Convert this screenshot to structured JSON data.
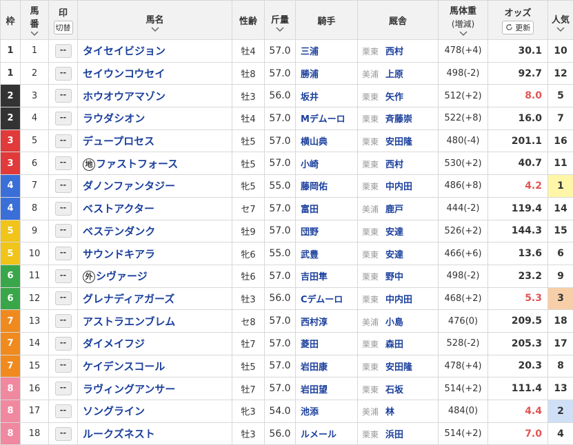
{
  "header": {
    "waku": "枠",
    "umaban_top": "馬",
    "umaban_bottom": "番",
    "mark": "印",
    "mark_toggle": "切替",
    "horse_name": "馬名",
    "sex_age": "性齢",
    "kinryo": "斤量",
    "jockey": "騎手",
    "stable": "厩舎",
    "body_weight": "馬体重",
    "body_weight_sub": "(増減)",
    "odds": "オッズ",
    "refresh": "更新",
    "popularity": "人気"
  },
  "mark_placeholder": "--",
  "colors": {
    "waku": {
      "1": "#ffffff",
      "2": "#333333",
      "3": "#e03a3a",
      "4": "#3a6fd8",
      "5": "#f0c419",
      "6": "#3aa64a",
      "7": "#f08a1e",
      "8": "#f088a0"
    },
    "name_blue": "#1a3f9c",
    "odds_red": "#e05555",
    "ninki1_bg": "#fff6a8",
    "ninki2_bg": "#cfe0f6",
    "ninki3_bg": "#f6cfa8"
  },
  "rows": [
    {
      "waku": "1",
      "umaban": "1",
      "name": "タイセイビジョン",
      "badge": "",
      "sex_age": "牡4",
      "weight": "57.0",
      "jockey": "三浦",
      "region": "栗東",
      "trainer": "西村",
      "bw": "478(+4)",
      "odds": "30.1",
      "hot": false,
      "ninki": "10"
    },
    {
      "waku": "1",
      "umaban": "2",
      "name": "セイウンコウセイ",
      "badge": "",
      "sex_age": "牡8",
      "weight": "57.0",
      "jockey": "勝浦",
      "region": "美浦",
      "trainer": "上原",
      "bw": "498(-2)",
      "odds": "92.7",
      "hot": false,
      "ninki": "12"
    },
    {
      "waku": "2",
      "umaban": "3",
      "name": "ホウオウアマゾン",
      "badge": "",
      "sex_age": "牡3",
      "weight": "56.0",
      "jockey": "坂井",
      "region": "栗東",
      "trainer": "矢作",
      "bw": "512(+2)",
      "odds": "8.0",
      "hot": true,
      "ninki": "5"
    },
    {
      "waku": "2",
      "umaban": "4",
      "name": "ラウダシオン",
      "badge": "",
      "sex_age": "牡4",
      "weight": "57.0",
      "jockey": "Mデムーロ",
      "region": "栗東",
      "trainer": "斉藤崇",
      "bw": "522(+8)",
      "odds": "16.0",
      "hot": false,
      "ninki": "7"
    },
    {
      "waku": "3",
      "umaban": "5",
      "name": "デュープロセス",
      "badge": "",
      "sex_age": "牡5",
      "weight": "57.0",
      "jockey": "横山典",
      "region": "栗東",
      "trainer": "安田隆",
      "bw": "480(-4)",
      "odds": "201.1",
      "hot": false,
      "ninki": "16"
    },
    {
      "waku": "3",
      "umaban": "6",
      "name": "ファストフォース",
      "badge": "地",
      "sex_age": "牡5",
      "weight": "57.0",
      "jockey": "小崎",
      "region": "栗東",
      "trainer": "西村",
      "bw": "530(+2)",
      "odds": "40.7",
      "hot": false,
      "ninki": "11"
    },
    {
      "waku": "4",
      "umaban": "7",
      "name": "ダノンファンタジー",
      "badge": "",
      "sex_age": "牝5",
      "weight": "55.0",
      "jockey": "藤岡佑",
      "region": "栗東",
      "trainer": "中内田",
      "bw": "486(+8)",
      "odds": "4.2",
      "hot": true,
      "ninki": "1"
    },
    {
      "waku": "4",
      "umaban": "8",
      "name": "ベストアクター",
      "badge": "",
      "sex_age": "セ7",
      "weight": "57.0",
      "jockey": "富田",
      "region": "美浦",
      "trainer": "鹿戸",
      "bw": "444(-2)",
      "odds": "119.4",
      "hot": false,
      "ninki": "14"
    },
    {
      "waku": "5",
      "umaban": "9",
      "name": "ベステンダンク",
      "badge": "",
      "sex_age": "牡9",
      "weight": "57.0",
      "jockey": "団野",
      "region": "栗東",
      "trainer": "安達",
      "bw": "526(+2)",
      "odds": "144.3",
      "hot": false,
      "ninki": "15"
    },
    {
      "waku": "5",
      "umaban": "10",
      "name": "サウンドキアラ",
      "badge": "",
      "sex_age": "牝6",
      "weight": "55.0",
      "jockey": "武豊",
      "region": "栗東",
      "trainer": "安達",
      "bw": "466(+6)",
      "odds": "13.6",
      "hot": false,
      "ninki": "6"
    },
    {
      "waku": "6",
      "umaban": "11",
      "name": "シヴァージ",
      "badge": "外",
      "sex_age": "牡6",
      "weight": "57.0",
      "jockey": "吉田隼",
      "region": "栗東",
      "trainer": "野中",
      "bw": "498(-2)",
      "odds": "23.2",
      "hot": false,
      "ninki": "9"
    },
    {
      "waku": "6",
      "umaban": "12",
      "name": "グレナディアガーズ",
      "badge": "",
      "sex_age": "牡3",
      "weight": "56.0",
      "jockey": "Cデムーロ",
      "region": "栗東",
      "trainer": "中内田",
      "bw": "468(+2)",
      "odds": "5.3",
      "hot": true,
      "ninki": "3"
    },
    {
      "waku": "7",
      "umaban": "13",
      "name": "アストラエンブレム",
      "badge": "",
      "sex_age": "セ8",
      "weight": "57.0",
      "jockey": "西村淳",
      "region": "美浦",
      "trainer": "小島",
      "bw": "476(0)",
      "odds": "209.5",
      "hot": false,
      "ninki": "18"
    },
    {
      "waku": "7",
      "umaban": "14",
      "name": "ダイメイフジ",
      "badge": "",
      "sex_age": "牡7",
      "weight": "57.0",
      "jockey": "菱田",
      "region": "栗東",
      "trainer": "森田",
      "bw": "528(-2)",
      "odds": "205.3",
      "hot": false,
      "ninki": "17"
    },
    {
      "waku": "7",
      "umaban": "15",
      "name": "ケイデンスコール",
      "badge": "",
      "sex_age": "牡5",
      "weight": "57.0",
      "jockey": "岩田康",
      "region": "栗東",
      "trainer": "安田隆",
      "bw": "478(+4)",
      "odds": "20.3",
      "hot": false,
      "ninki": "8"
    },
    {
      "waku": "8",
      "umaban": "16",
      "name": "ラヴィングアンサー",
      "badge": "",
      "sex_age": "牡7",
      "weight": "57.0",
      "jockey": "岩田望",
      "region": "栗東",
      "trainer": "石坂",
      "bw": "514(+2)",
      "odds": "111.4",
      "hot": false,
      "ninki": "13"
    },
    {
      "waku": "8",
      "umaban": "17",
      "name": "ソングライン",
      "badge": "",
      "sex_age": "牝3",
      "weight": "54.0",
      "jockey": "池添",
      "region": "美浦",
      "trainer": "林",
      "bw": "484(0)",
      "odds": "4.4",
      "hot": true,
      "ninki": "2"
    },
    {
      "waku": "8",
      "umaban": "18",
      "name": "ルークズネスト",
      "badge": "",
      "sex_age": "牡3",
      "weight": "56.0",
      "jockey": "ルメール",
      "region": "栗東",
      "trainer": "浜田",
      "bw": "514(+2)",
      "odds": "7.0",
      "hot": true,
      "ninki": "4"
    }
  ]
}
